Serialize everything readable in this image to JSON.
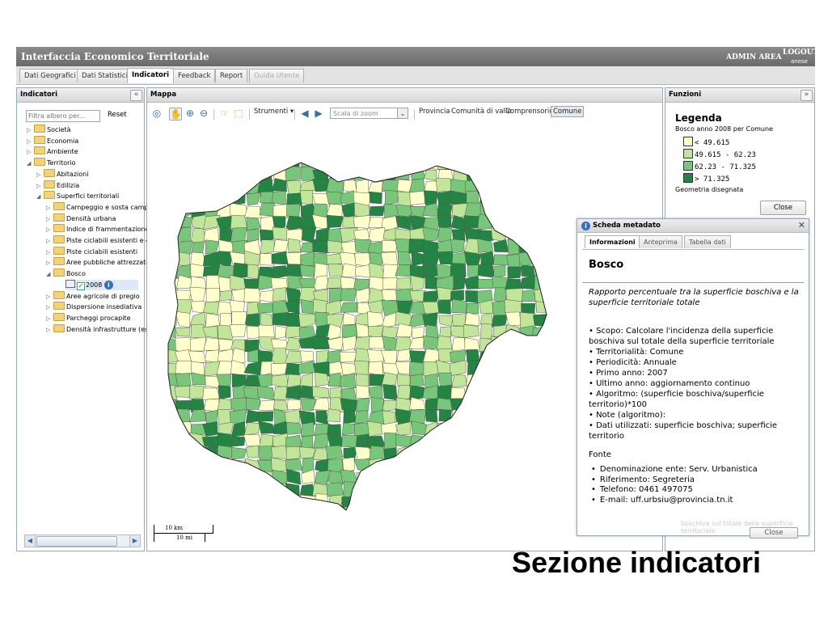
{
  "app": {
    "title": "Interfaccia Economico Territoriale",
    "admin_area": "ADMIN AREA",
    "logout": "LOGOUT",
    "user": "anese"
  },
  "tabs": [
    {
      "label": "Dati Geografici",
      "active": false,
      "disabled": false
    },
    {
      "label": "Dati Statistici",
      "active": false,
      "disabled": false
    },
    {
      "label": "Indicatori",
      "active": true,
      "disabled": false
    },
    {
      "label": "Feedback",
      "active": false,
      "disabled": false
    },
    {
      "label": "Report",
      "active": false,
      "disabled": false
    },
    {
      "label": "Guida Utente",
      "active": false,
      "disabled": true
    }
  ],
  "left_panel": {
    "title": "Indicatori",
    "collapse": "«",
    "filter_placeholder": "Filtra albero per...",
    "reset": "Reset",
    "tree": [
      {
        "label": "Società",
        "level": 0,
        "expanded": false
      },
      {
        "label": "Economia",
        "level": 0,
        "expanded": false
      },
      {
        "label": "Ambiente",
        "level": 0,
        "expanded": false
      },
      {
        "label": "Territorio",
        "level": 0,
        "expanded": true
      },
      {
        "label": "Abitazioni",
        "level": 1,
        "expanded": false
      },
      {
        "label": "Edilizia",
        "level": 1,
        "expanded": false
      },
      {
        "label": "Superfici territoriali",
        "level": 1,
        "expanded": true
      },
      {
        "label": "Campeggio e sosta campi",
        "level": 2,
        "expanded": false
      },
      {
        "label": "Densità urbana",
        "level": 2,
        "expanded": false
      },
      {
        "label": "Indice di frammentazione",
        "level": 2,
        "expanded": false
      },
      {
        "label": "Piste ciclabili esistenti e di",
        "level": 2,
        "expanded": false
      },
      {
        "label": "Piste ciclabili esistenti",
        "level": 2,
        "expanded": false
      },
      {
        "label": "Aree pubbliche attrezzate",
        "level": 2,
        "expanded": false
      },
      {
        "label": "Bosco",
        "level": 2,
        "expanded": true
      },
      {
        "label": "2008",
        "level": 3,
        "leaf": true,
        "checked": true
      },
      {
        "label": "Aree agricole di pregio",
        "level": 2,
        "expanded": false
      },
      {
        "label": "Dispersione insediativa",
        "level": 2,
        "expanded": false
      },
      {
        "label": "Parcheggi procapite",
        "level": 2,
        "expanded": false
      },
      {
        "label": "Densità infrastrutture (esi",
        "level": 2,
        "expanded": false
      }
    ]
  },
  "map_panel": {
    "title": "Mappa",
    "strumenti": "Strumenti",
    "zoom_placeholder": "Scala di zoom",
    "levels": [
      "Provincia",
      "Comunità di valle",
      "Comprensorio",
      "Comune"
    ],
    "active_level": "Comune",
    "scale_km": "10 km",
    "scale_mi": "10 mi",
    "colors": [
      "#ffffcc",
      "#c2e699",
      "#78c679",
      "#238443"
    ]
  },
  "right_panel": {
    "title": "Funzioni",
    "collapse": "»",
    "legend_title": "Legenda",
    "legend_subtitle": "Bosco anno 2008 per Comune",
    "legend": [
      {
        "label": "< 49.615",
        "color": "#ffffcc"
      },
      {
        "label": "49.615 - 62.23",
        "color": "#c2e699"
      },
      {
        "label": "62.23 - 71.325",
        "color": "#78c679"
      },
      {
        "label": "> 71.325",
        "color": "#238443"
      }
    ],
    "geometry": "Geometria disegnata",
    "close": "Close"
  },
  "metadata": {
    "window_title": "Scheda metadato",
    "tabs": [
      "Informazioni",
      "Anteprima",
      "Tabella dati"
    ],
    "name": "Bosco",
    "description": "Rapporto percentuale tra la superficie boschiva e la superficie territoriale totale",
    "items": [
      "Scopo: Calcolare l'incidenza della superficie boschiva sul totale della superficie territoriale",
      "Territorialità: Comune",
      "Periodicità: Annuale",
      "Primo anno: 2007",
      "Ultimo anno: aggiornamento continuo",
      "Algoritmo: (superficie boschiva/superficie territorio)*100",
      "Note (algoritmo):",
      "Dati utilizzati: superficie boschiva; superficie territorio"
    ],
    "fonte": "Fonte",
    "contacts": [
      "Denominazione ente: Serv. Urbanistica",
      "Riferimento: Segreteria",
      "Telefono: 0461 497075",
      "E-mail: uff.urbsiu@provincia.tn.it"
    ],
    "ghost_text": "boschiva sul totale della superficie territoriale",
    "ghost_close": "Close"
  },
  "caption": "Sezione indicatori"
}
